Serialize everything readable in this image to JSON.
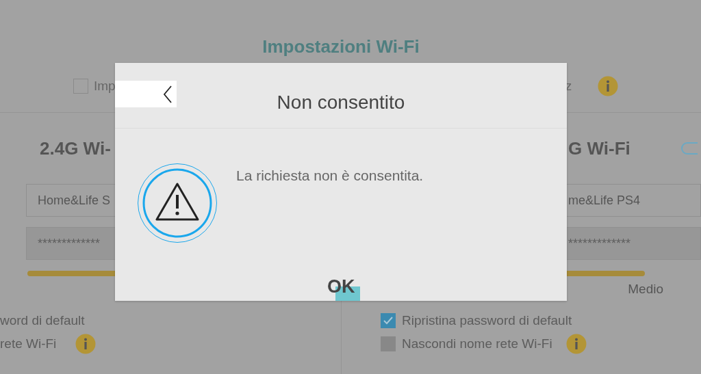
{
  "page": {
    "title": "Impostazioni Wi-Fi",
    "option": {
      "label": "Imp",
      "checked": false
    },
    "option_tail": "z"
  },
  "left": {
    "heading": "2.4G Wi-",
    "ssid": "Home&Life S",
    "password": "*************",
    "checkboxes": [
      {
        "label": "word di default",
        "info": false
      },
      {
        "label": "rete Wi-Fi",
        "info": true
      }
    ]
  },
  "right": {
    "heading": "G Wi-Fi",
    "toggle_on": false,
    "ssid": "me&Life PS4",
    "password": "*************",
    "strength": "Medio",
    "checkboxes": [
      {
        "label": "Ripristina password di default",
        "checked": true,
        "info": false
      },
      {
        "label": "Nascondi nome rete Wi-Fi",
        "checked": false,
        "info": true
      }
    ]
  },
  "dialog": {
    "title": "Non consentito",
    "message": "La richiesta non è consentita.",
    "button": "OK"
  }
}
